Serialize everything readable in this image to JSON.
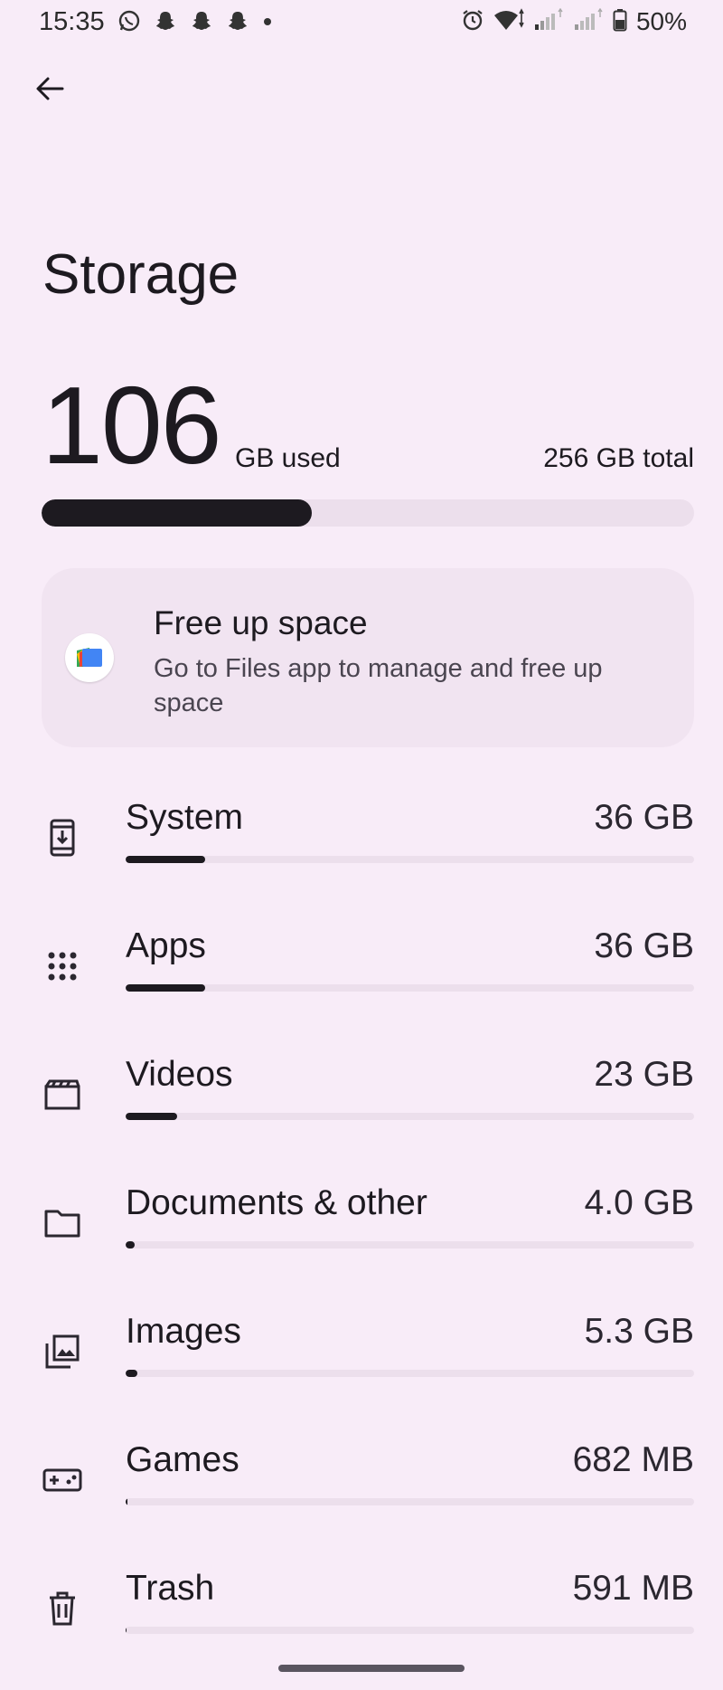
{
  "status_bar": {
    "time": "15:35",
    "left_icons": [
      "whatsapp-icon",
      "snapchat-icon",
      "snapchat-icon",
      "snapchat-icon",
      "dot-icon"
    ],
    "right_icons": [
      "alarm-icon",
      "wifi-icon",
      "signal-icon",
      "signal-icon",
      "battery-icon"
    ],
    "battery_text": "50%"
  },
  "header": {
    "back_icon": "arrow-back-icon"
  },
  "title": "Storage",
  "usage": {
    "used_value": "106",
    "used_unit": "GB used",
    "total": "256 GB total",
    "used_fraction": 0.414
  },
  "free_up_card": {
    "title": "Free up space",
    "description": "Go to Files app to manage and free up space",
    "icon": "files-app-icon"
  },
  "categories": [
    {
      "label": "System",
      "size": "36 GB",
      "fraction": 0.14,
      "icon": "system-update-icon"
    },
    {
      "label": "Apps",
      "size": "36 GB",
      "fraction": 0.14,
      "icon": "apps-grid-icon"
    },
    {
      "label": "Videos",
      "size": "23 GB",
      "fraction": 0.09,
      "icon": "movie-clapper-icon"
    },
    {
      "label": "Documents & other",
      "size": "4.0 GB",
      "fraction": 0.016,
      "icon": "folder-icon"
    },
    {
      "label": "Images",
      "size": "5.3 GB",
      "fraction": 0.021,
      "icon": "image-library-icon"
    },
    {
      "label": "Games",
      "size": "682 MB",
      "fraction": 0.003,
      "icon": "gamepad-icon"
    },
    {
      "label": "Trash",
      "size": "591 MB",
      "fraction": 0.002,
      "icon": "trash-icon"
    }
  ],
  "colors": {
    "background": "#f8ecf8",
    "bar_track": "#ecdfec",
    "bar_fill": "#1d1a20",
    "card_bg": "#f1e4f1"
  }
}
